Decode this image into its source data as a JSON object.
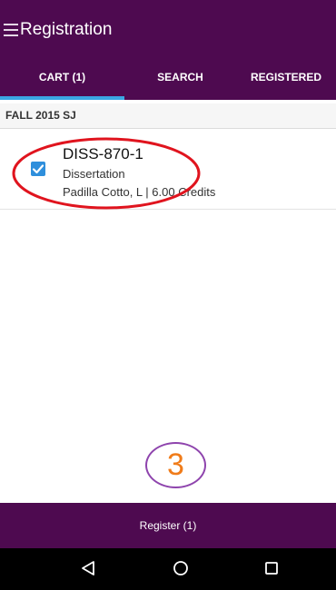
{
  "app": {
    "title": "Registration"
  },
  "tabs": [
    {
      "label": "CART (1)",
      "active": true
    },
    {
      "label": "SEARCH",
      "active": false
    },
    {
      "label": "REGISTERED",
      "active": false
    }
  ],
  "section": {
    "title": "FALL 2015 SJ"
  },
  "course": {
    "code": "DISS-870-1",
    "title": "Dissertation",
    "meta": "Padilla Cotto, L | 6.00 Credits",
    "checked": true
  },
  "annotation": {
    "step": "3"
  },
  "footer": {
    "register_label": "Register (1)"
  },
  "nav": {
    "icons": [
      "back-icon",
      "home-icon",
      "recents-icon"
    ]
  },
  "colors": {
    "primary": "#4e0a50",
    "tab_indicator": "#3aa6e3",
    "checkbox": "#2f8fdc",
    "annotation_ellipse": "#e0141e",
    "step_number": "#f07c1a",
    "step_circle": "#8e44ad"
  }
}
